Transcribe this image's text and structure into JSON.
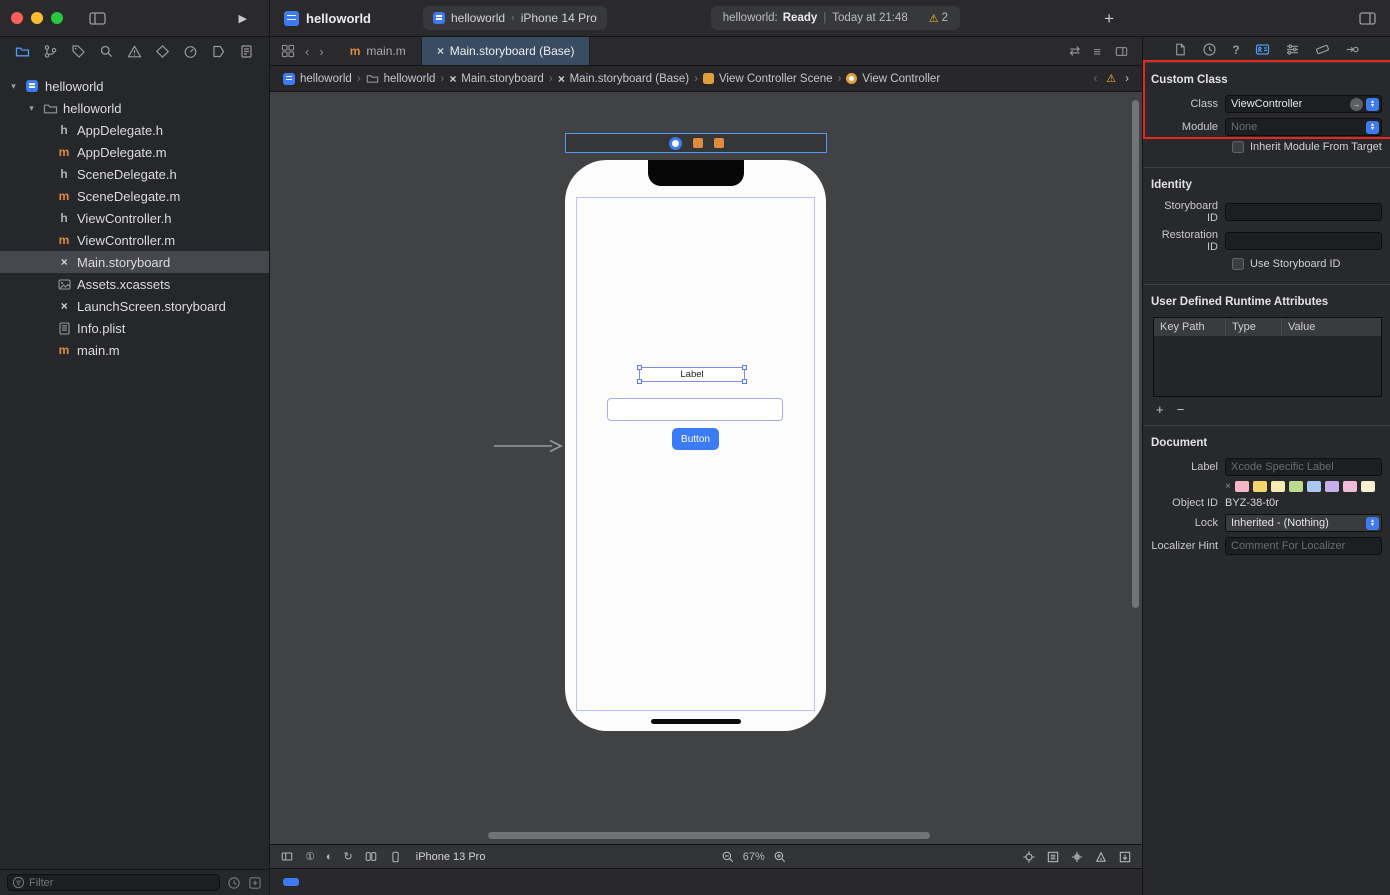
{
  "colors": {
    "accent_blue": "#4f9cf7",
    "ib_button_blue": "#3b7bf7",
    "warning_yellow": "#f6bf2e",
    "annotation_red": "#e8281e",
    "active_tab_blue_gray": "#3a4c61"
  },
  "icons": {
    "play": "▶",
    "plus": "+",
    "minus": "−",
    "chevron": "›",
    "back": "‹",
    "forward": "›",
    "disclosure_open": "▾",
    "warning": "⚠",
    "swap": "⇄",
    "list": "≡",
    "circle_one": "①",
    "appearance": "◐",
    "rotate": "↻",
    "storyboard_x": "×",
    "clear_x": "×",
    "question": "?",
    "dd_up": "▴",
    "dd_down": "▾",
    "file_h": "h",
    "file_m": "m"
  },
  "titlebar": {
    "project_title": "helloworld",
    "scheme_target": "helloworld",
    "scheme_destination": "iPhone 14 Pro",
    "status_project": "helloworld:",
    "status_state": "Ready",
    "status_separator": "|",
    "status_time": "Today at 21:48",
    "warning_count": "2"
  },
  "navigator": {
    "tree": [
      {
        "label": "helloworld"
      },
      {
        "label": "helloworld"
      },
      {
        "label": "AppDelegate.h"
      },
      {
        "label": "AppDelegate.m"
      },
      {
        "label": "SceneDelegate.h"
      },
      {
        "label": "SceneDelegate.m"
      },
      {
        "label": "ViewController.h"
      },
      {
        "label": "ViewController.m"
      },
      {
        "label": "Main.storyboard"
      },
      {
        "label": "Assets.xcassets"
      },
      {
        "label": "LaunchScreen.storyboard"
      },
      {
        "label": "Info.plist"
      },
      {
        "label": "main.m"
      }
    ],
    "filter_placeholder": "Filter"
  },
  "editor": {
    "tabs": {
      "main_m": "main.m",
      "storyboard": "Main.storyboard (Base)"
    },
    "breadcrumbs": {
      "b1": "helloworld",
      "b2": "helloworld",
      "b3": "Main.storyboard",
      "b4": "Main.storyboard (Base)",
      "b5": "View Controller Scene",
      "b6": "View Controller"
    },
    "canvas": {
      "label_text": "Label",
      "button_text": "Button"
    },
    "bar": {
      "device": "iPhone 13 Pro",
      "zoom": "67%"
    }
  },
  "inspector": {
    "custom_class": {
      "title": "Custom Class",
      "class_label": "Class",
      "class_value": "ViewController",
      "module_label": "Module",
      "module_placeholder": "None",
      "inherit_module_label": "Inherit Module From Target"
    },
    "identity": {
      "title": "Identity",
      "storyboard_id_label": "Storyboard ID",
      "restoration_id_label": "Restoration ID",
      "use_storyboard_id_label": "Use Storyboard ID"
    },
    "runtime_attributes": {
      "title": "User Defined Runtime Attributes",
      "col_key_path": "Key Path",
      "col_type": "Type",
      "col_value": "Value"
    },
    "document": {
      "title": "Document",
      "label_label": "Label",
      "label_placeholder": "Xcode Specific Label",
      "object_id_label": "Object ID",
      "object_id_value": "BYZ-38-t0r",
      "lock_label": "Lock",
      "lock_value": "Inherited - (Nothing)",
      "localizer_label": "Localizer Hint",
      "localizer_placeholder": "Comment For Localizer"
    },
    "swatch_colors": [
      "#f7b6c6",
      "#f6d56e",
      "#f3ecb0",
      "#bcdb90",
      "#a9c9f2",
      "#c7b0ea",
      "#f0bcdc",
      "#f6f0cf"
    ]
  }
}
